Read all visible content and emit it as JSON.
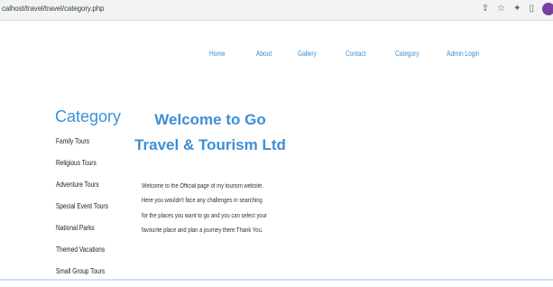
{
  "browser": {
    "url": "calhost/travel/travel/category.php",
    "icons": [
      "share-icon",
      "star-icon",
      "extensions-icon",
      "sidepanel-icon",
      "profile-avatar"
    ]
  },
  "nav": {
    "items": [
      "Home",
      "About",
      "Gallery",
      "Contact",
      "Category",
      "Admin Login"
    ]
  },
  "sidebar": {
    "title": "Category",
    "items": [
      "Family Tours",
      "Religious Tours",
      "Adventure Tours",
      "Special Event Tours",
      "National Parks",
      "Themed Vacations",
      "Small Group Tours"
    ]
  },
  "main": {
    "heading": "Welcome to Go Travel & Tourism Ltd",
    "lines": [
      "Welcome to the Official page of my tourism website.",
      "Here you wouldn't face any challenges in searching",
      "for the places you want to go and you can select your",
      "favourite place and plan a journey there.Thank You."
    ]
  },
  "colors": {
    "accent": "#3d8fd6",
    "text": "#222222",
    "browser_bar": "#f1f3f4"
  }
}
